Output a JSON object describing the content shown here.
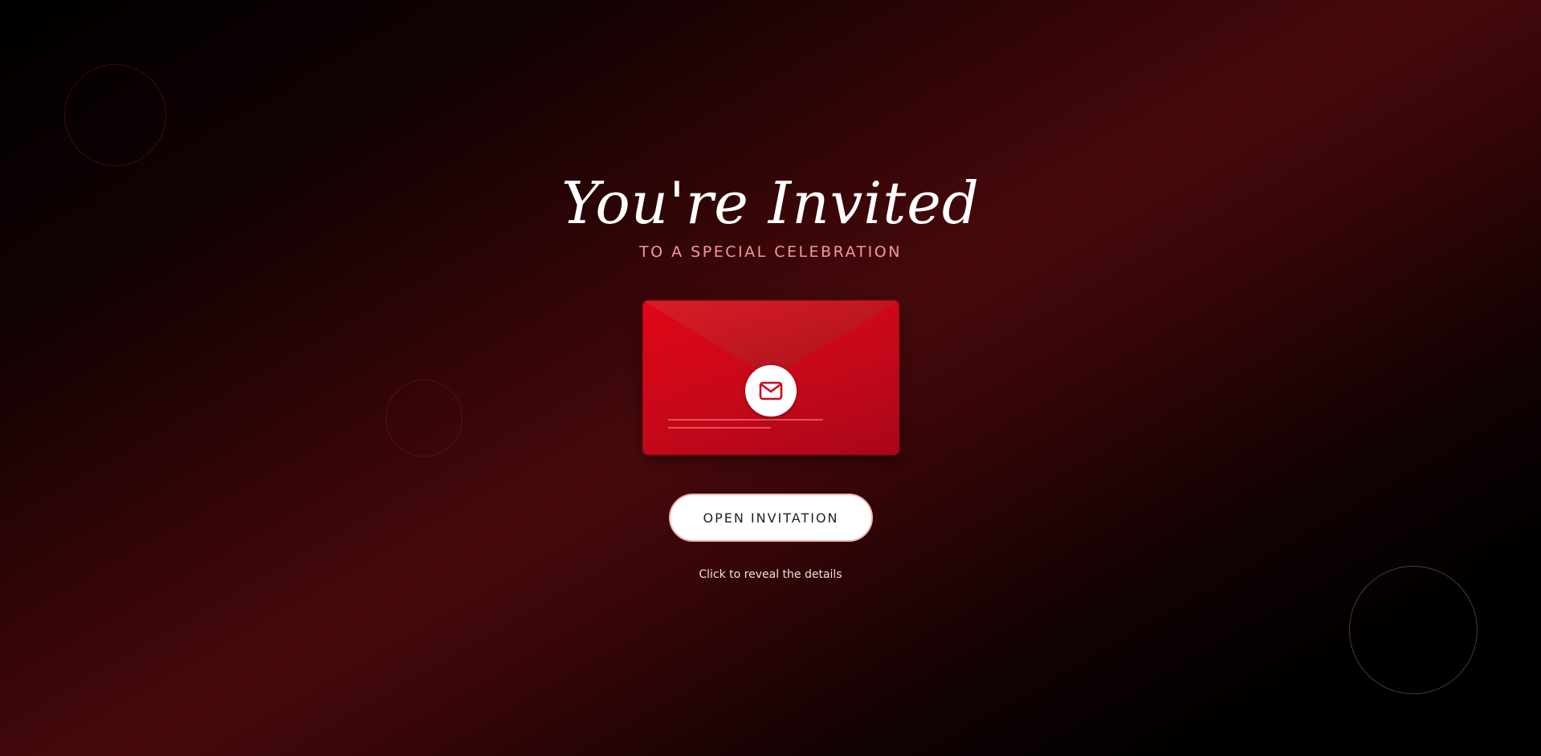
{
  "hero": {
    "title": "You're Invited",
    "subtitle": "TO A SPECIAL CELEBRATION"
  },
  "envelope": {
    "seal_icon": "mail-icon",
    "color": "#d0081a"
  },
  "actions": {
    "open_label": "OPEN INVITATION",
    "hint": "Click to reveal the details"
  },
  "theme": {
    "accent": "#d0081a",
    "subtitle_color": "#f39a9a",
    "background_dark": "#000000",
    "background_red": "#460a0c"
  }
}
